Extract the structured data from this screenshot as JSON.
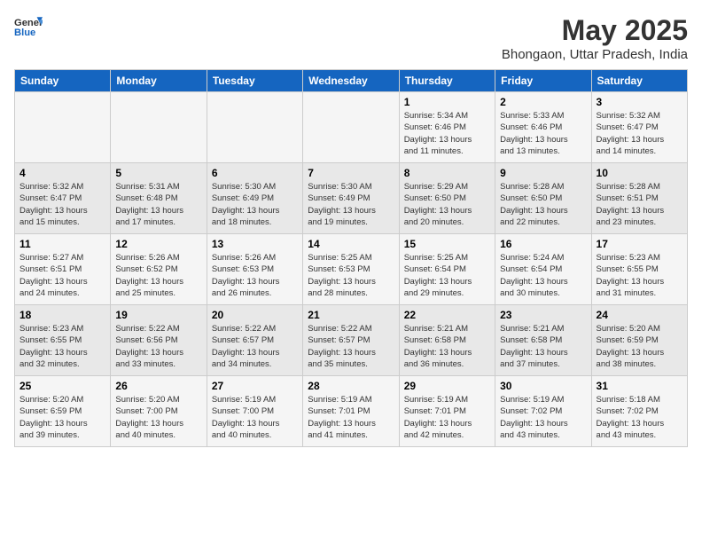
{
  "header": {
    "logo_general": "General",
    "logo_blue": "Blue",
    "month": "May 2025",
    "location": "Bhongaon, Uttar Pradesh, India"
  },
  "days_of_week": [
    "Sunday",
    "Monday",
    "Tuesday",
    "Wednesday",
    "Thursday",
    "Friday",
    "Saturday"
  ],
  "weeks": [
    [
      {
        "day": "",
        "content": ""
      },
      {
        "day": "",
        "content": ""
      },
      {
        "day": "",
        "content": ""
      },
      {
        "day": "",
        "content": ""
      },
      {
        "day": "1",
        "content": "Sunrise: 5:34 AM\nSunset: 6:46 PM\nDaylight: 13 hours\nand 11 minutes."
      },
      {
        "day": "2",
        "content": "Sunrise: 5:33 AM\nSunset: 6:46 PM\nDaylight: 13 hours\nand 13 minutes."
      },
      {
        "day": "3",
        "content": "Sunrise: 5:32 AM\nSunset: 6:47 PM\nDaylight: 13 hours\nand 14 minutes."
      }
    ],
    [
      {
        "day": "4",
        "content": "Sunrise: 5:32 AM\nSunset: 6:47 PM\nDaylight: 13 hours\nand 15 minutes."
      },
      {
        "day": "5",
        "content": "Sunrise: 5:31 AM\nSunset: 6:48 PM\nDaylight: 13 hours\nand 17 minutes."
      },
      {
        "day": "6",
        "content": "Sunrise: 5:30 AM\nSunset: 6:49 PM\nDaylight: 13 hours\nand 18 minutes."
      },
      {
        "day": "7",
        "content": "Sunrise: 5:30 AM\nSunset: 6:49 PM\nDaylight: 13 hours\nand 19 minutes."
      },
      {
        "day": "8",
        "content": "Sunrise: 5:29 AM\nSunset: 6:50 PM\nDaylight: 13 hours\nand 20 minutes."
      },
      {
        "day": "9",
        "content": "Sunrise: 5:28 AM\nSunset: 6:50 PM\nDaylight: 13 hours\nand 22 minutes."
      },
      {
        "day": "10",
        "content": "Sunrise: 5:28 AM\nSunset: 6:51 PM\nDaylight: 13 hours\nand 23 minutes."
      }
    ],
    [
      {
        "day": "11",
        "content": "Sunrise: 5:27 AM\nSunset: 6:51 PM\nDaylight: 13 hours\nand 24 minutes."
      },
      {
        "day": "12",
        "content": "Sunrise: 5:26 AM\nSunset: 6:52 PM\nDaylight: 13 hours\nand 25 minutes."
      },
      {
        "day": "13",
        "content": "Sunrise: 5:26 AM\nSunset: 6:53 PM\nDaylight: 13 hours\nand 26 minutes."
      },
      {
        "day": "14",
        "content": "Sunrise: 5:25 AM\nSunset: 6:53 PM\nDaylight: 13 hours\nand 28 minutes."
      },
      {
        "day": "15",
        "content": "Sunrise: 5:25 AM\nSunset: 6:54 PM\nDaylight: 13 hours\nand 29 minutes."
      },
      {
        "day": "16",
        "content": "Sunrise: 5:24 AM\nSunset: 6:54 PM\nDaylight: 13 hours\nand 30 minutes."
      },
      {
        "day": "17",
        "content": "Sunrise: 5:23 AM\nSunset: 6:55 PM\nDaylight: 13 hours\nand 31 minutes."
      }
    ],
    [
      {
        "day": "18",
        "content": "Sunrise: 5:23 AM\nSunset: 6:55 PM\nDaylight: 13 hours\nand 32 minutes."
      },
      {
        "day": "19",
        "content": "Sunrise: 5:22 AM\nSunset: 6:56 PM\nDaylight: 13 hours\nand 33 minutes."
      },
      {
        "day": "20",
        "content": "Sunrise: 5:22 AM\nSunset: 6:57 PM\nDaylight: 13 hours\nand 34 minutes."
      },
      {
        "day": "21",
        "content": "Sunrise: 5:22 AM\nSunset: 6:57 PM\nDaylight: 13 hours\nand 35 minutes."
      },
      {
        "day": "22",
        "content": "Sunrise: 5:21 AM\nSunset: 6:58 PM\nDaylight: 13 hours\nand 36 minutes."
      },
      {
        "day": "23",
        "content": "Sunrise: 5:21 AM\nSunset: 6:58 PM\nDaylight: 13 hours\nand 37 minutes."
      },
      {
        "day": "24",
        "content": "Sunrise: 5:20 AM\nSunset: 6:59 PM\nDaylight: 13 hours\nand 38 minutes."
      }
    ],
    [
      {
        "day": "25",
        "content": "Sunrise: 5:20 AM\nSunset: 6:59 PM\nDaylight: 13 hours\nand 39 minutes."
      },
      {
        "day": "26",
        "content": "Sunrise: 5:20 AM\nSunset: 7:00 PM\nDaylight: 13 hours\nand 40 minutes."
      },
      {
        "day": "27",
        "content": "Sunrise: 5:19 AM\nSunset: 7:00 PM\nDaylight: 13 hours\nand 40 minutes."
      },
      {
        "day": "28",
        "content": "Sunrise: 5:19 AM\nSunset: 7:01 PM\nDaylight: 13 hours\nand 41 minutes."
      },
      {
        "day": "29",
        "content": "Sunrise: 5:19 AM\nSunset: 7:01 PM\nDaylight: 13 hours\nand 42 minutes."
      },
      {
        "day": "30",
        "content": "Sunrise: 5:19 AM\nSunset: 7:02 PM\nDaylight: 13 hours\nand 43 minutes."
      },
      {
        "day": "31",
        "content": "Sunrise: 5:18 AM\nSunset: 7:02 PM\nDaylight: 13 hours\nand 43 minutes."
      }
    ]
  ]
}
